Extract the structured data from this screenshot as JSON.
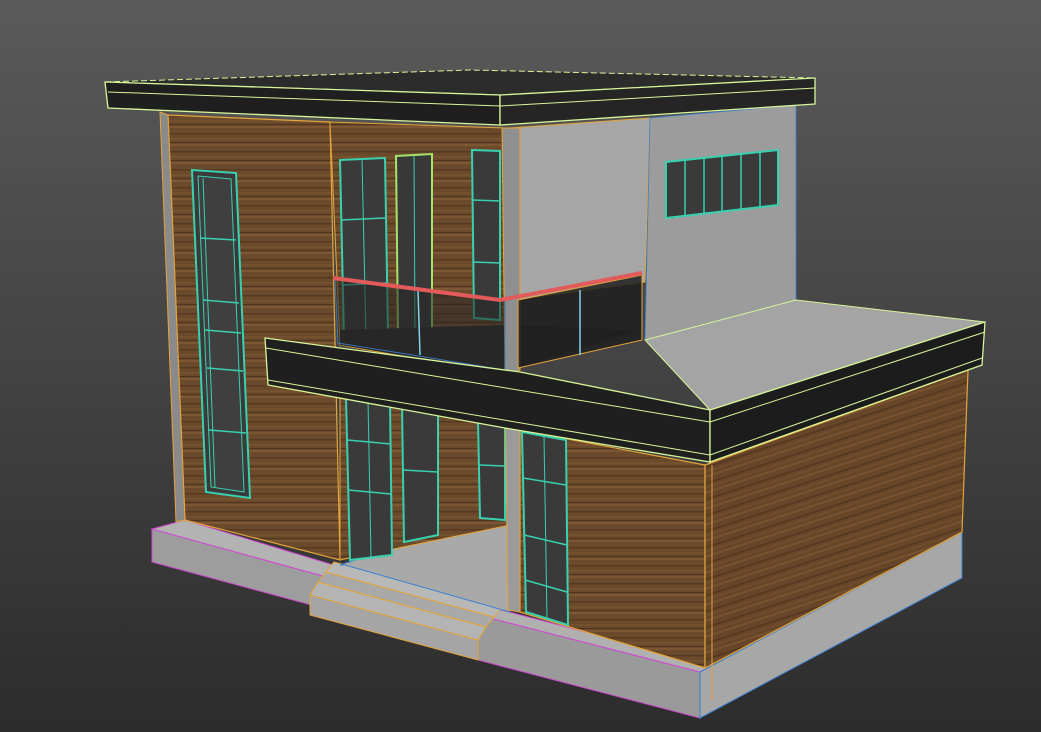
{
  "viewport": {
    "background_top": "#5a5a5a",
    "background_bottom": "#2c2c2c"
  },
  "palette": {
    "wood": "#6b4a2c",
    "wood_dark": "#5a3d24",
    "plaster": "#9a9a9a",
    "plaster_light": "#a8a8a8",
    "fascia": "#1f1f1f",
    "roof_top": "#2a2a2a",
    "glass": "#3b3b3b",
    "wire_roof": "#d8f59a",
    "wire_wood": "#e3a53a",
    "wire_window": "#39d0b0",
    "wire_base": "#d04ad0",
    "wire_rail": "#e25a5a",
    "wire_ground": "#3a7fd0"
  },
  "model": {
    "name": "two-story-modern-house",
    "selected": true
  }
}
